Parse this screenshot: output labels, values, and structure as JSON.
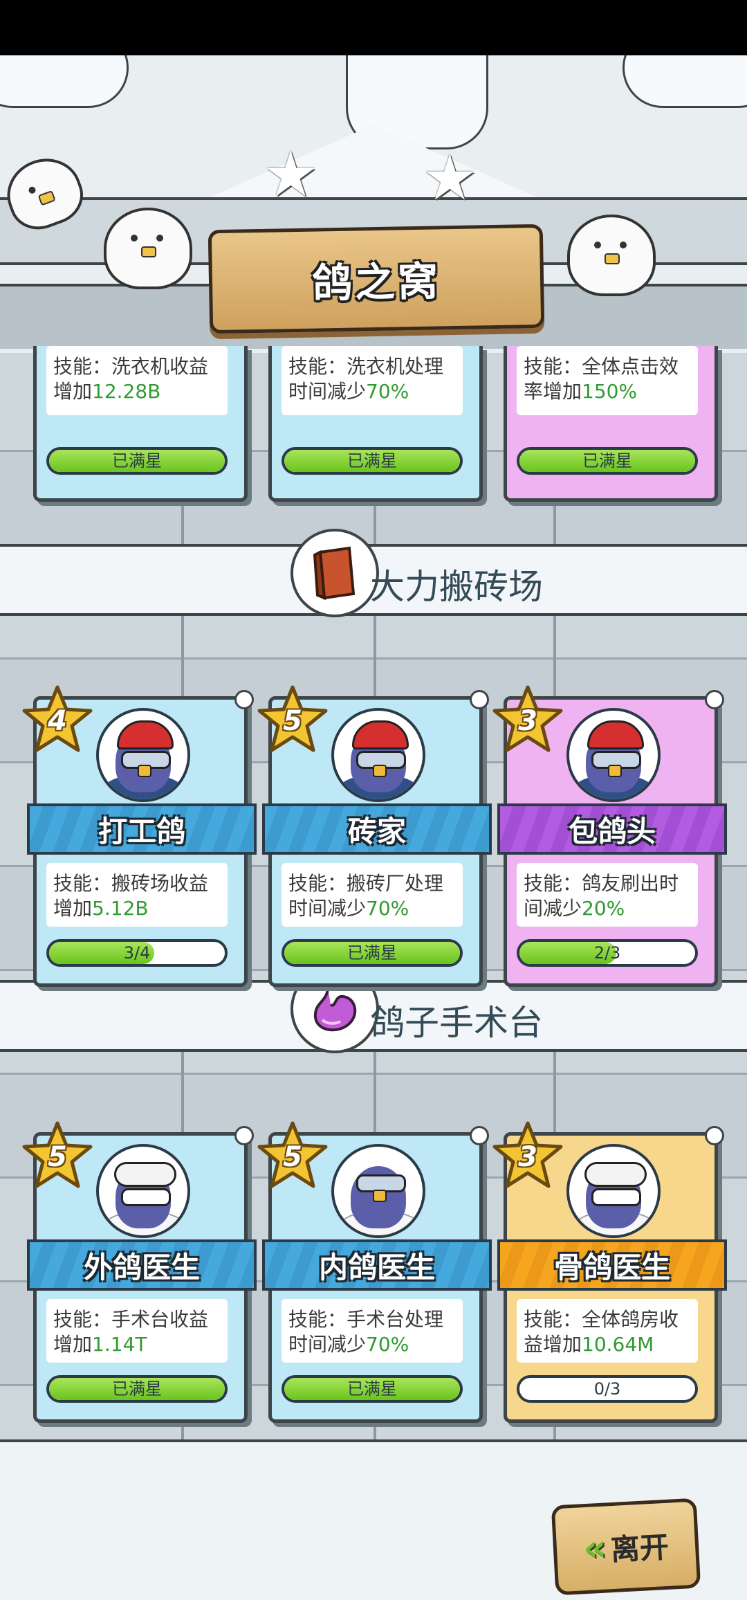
{
  "title": "鸽之窝",
  "leave_label": "离开",
  "colors": {
    "value_green": "#2f9a2f",
    "banner_blue": "#46a9de",
    "banner_purple": "#b25ce2",
    "banner_gold": "#f6a51e"
  },
  "top_cards": [
    {
      "skill_prefix": "技能：洗衣机收益增加",
      "skill_value": "12.28B",
      "progress_label": "已满星",
      "progress": 1.0,
      "theme": "blue"
    },
    {
      "skill_prefix": "技能：洗衣机处理时间减少",
      "skill_value": "70%",
      "progress_label": "已满星",
      "progress": 1.0,
      "theme": "blue"
    },
    {
      "skill_prefix": "技能：全体点击效率增加",
      "skill_value": "150%",
      "progress_label": "已满星",
      "progress": 1.0,
      "theme": "purple"
    }
  ],
  "sections": [
    {
      "name": "大力搬砖场",
      "icon": "brick-icon",
      "cards": [
        {
          "stars": "4",
          "name": "打工鸽",
          "skill_prefix": "技能：搬砖场收益增加",
          "skill_value": "5.12B",
          "progress_label": "3/4",
          "progress": 0.6,
          "theme": "blue"
        },
        {
          "stars": "5",
          "name": "砖家",
          "skill_prefix": "技能：搬砖厂处理时间减少",
          "skill_value": "70%",
          "progress_label": "已满星",
          "progress": 1.0,
          "theme": "blue"
        },
        {
          "stars": "3",
          "name": "包鸽头",
          "skill_prefix": "技能：鸽友刷出时间减少",
          "skill_value": "20%",
          "progress_label": "2/3",
          "progress": 0.55,
          "theme": "purple"
        }
      ]
    },
    {
      "name": "鸽子手术台",
      "icon": "stomach-icon",
      "cards": [
        {
          "stars": "5",
          "name": "外鸽医生",
          "skill_prefix": "技能：手术台收益增加",
          "skill_value": "1.14T",
          "progress_label": "已满星",
          "progress": 1.0,
          "theme": "blue"
        },
        {
          "stars": "5",
          "name": "内鸽医生",
          "skill_prefix": "技能：手术台处理时间减少",
          "skill_value": "70%",
          "progress_label": "已满星",
          "progress": 1.0,
          "theme": "blue"
        },
        {
          "stars": "3",
          "name": "骨鸽医生",
          "skill_prefix": "技能：全体鸽房收益增加",
          "skill_value": "10.64M",
          "progress_label": "0/3",
          "progress": 0.0,
          "theme": "gold"
        }
      ]
    }
  ]
}
